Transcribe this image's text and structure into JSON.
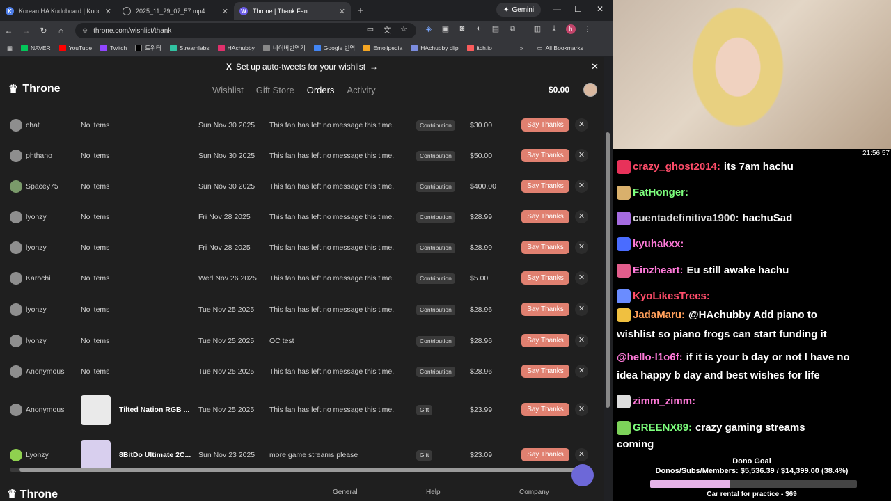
{
  "browser": {
    "tabs": [
      {
        "title": "Korean HA Kudoboard | Kudob",
        "favicon": "K"
      },
      {
        "title": "2025_11_29_07_57.mp4",
        "favicon": "globe"
      },
      {
        "title": "Throne | Thank Fan",
        "favicon": "W"
      }
    ],
    "gemini": "Gemini",
    "url": "throne.com/wishlist/thank",
    "bookmarks": [
      "NAVER",
      "YouTube",
      "Twitch",
      "트위터",
      "Streamlabs",
      "HAchubby",
      "네이버번역기",
      "Google 번역",
      "Emojipedia",
      "HAchubby clip",
      "itch.io"
    ],
    "all_bookmarks": "All Bookmarks"
  },
  "throne": {
    "banner": "Set up auto-tweets for your wishlist",
    "logo": "Throne",
    "nav": [
      "Wishlist",
      "Gift Store",
      "Orders",
      "Activity"
    ],
    "balance": "$0.00",
    "rows": [
      {
        "user": "chat",
        "items": "No items",
        "date": "Sun Nov 30 2025",
        "message": "This fan has left no message this time.",
        "type": "Contribution",
        "amount": "$30.00"
      },
      {
        "user": "phthano",
        "items": "No items",
        "date": "Sun Nov 30 2025",
        "message": "This fan has left no message this time.",
        "type": "Contribution",
        "amount": "$50.00"
      },
      {
        "user": "Spacey75",
        "items": "No items",
        "date": "Sun Nov 30 2025",
        "message": "This fan has left no message this time.",
        "type": "Contribution",
        "amount": "$400.00"
      },
      {
        "user": "lyonzy",
        "items": "No items",
        "date": "Fri Nov 28 2025",
        "message": "This fan has left no message this time.",
        "type": "Contribution",
        "amount": "$28.99"
      },
      {
        "user": "lyonzy",
        "items": "No items",
        "date": "Fri Nov 28 2025",
        "message": "This fan has left no message this time.",
        "type": "Contribution",
        "amount": "$28.99"
      },
      {
        "user": "Karochi",
        "items": "No items",
        "date": "Wed Nov 26 2025",
        "message": "This fan has left no message this time.",
        "type": "Contribution",
        "amount": "$5.00"
      },
      {
        "user": "lyonzy",
        "items": "No items",
        "date": "Tue Nov 25 2025",
        "message": "This fan has left no message this time.",
        "type": "Contribution",
        "amount": "$28.96"
      },
      {
        "user": "lyonzy",
        "items": "No items",
        "date": "Tue Nov 25 2025",
        "message": "OC test",
        "type": "Contribution",
        "amount": "$28.96"
      },
      {
        "user": "Anonymous",
        "items": "No items",
        "date": "Tue Nov 25 2025",
        "message": "This fan has left no message this time.",
        "type": "Contribution",
        "amount": "$28.96"
      },
      {
        "user": "Anonymous",
        "items": "Tilted Nation RGB ...",
        "date": "Tue Nov 25 2025",
        "message": "This fan has left no message this time.",
        "type": "Gift",
        "amount": "$23.99"
      },
      {
        "user": "Lyonzy",
        "items": "8BitDo Ultimate 2C...",
        "date": "Sun Nov 23 2025",
        "message": "more game streams please",
        "type": "Gift",
        "amount": "$23.09"
      }
    ],
    "say_thanks": "Say Thanks",
    "footer": {
      "logo": "Throne",
      "cols": [
        "General",
        "Help",
        "Company"
      ]
    }
  },
  "stream": {
    "clock": "21:56:57",
    "chat": [
      {
        "user": "crazy_ghost2014:",
        "color": "#ff4d6a",
        "text": "its 7am hachu"
      },
      {
        "user": "FatHonger:",
        "color": "#7dff7d",
        "text": ""
      },
      {
        "user": "cuentadefinitiva1900:",
        "color": "#dcdcdc",
        "text": "hachuSad"
      },
      {
        "user": "kyuhakxx:",
        "color": "#ff7ad9",
        "text": ""
      },
      {
        "user": "Einzheart:",
        "color": "#ff7ad9",
        "text": "Eu still awake hachu"
      },
      {
        "user": "KyoLikesTrees:",
        "color": "#ff4d6a",
        "text": ""
      },
      {
        "user": "JadaMaru:",
        "color": "#ff9f5a",
        "text": "@HAchubby Add piano to"
      },
      {
        "user": "",
        "color": "#ffffff",
        "text": "wishlist so piano frogs can start funding it"
      },
      {
        "user": "@hello-l1o6f:",
        "color": "#ff7ad9",
        "text": "if it is your b day or not I have no"
      },
      {
        "user": "",
        "color": "#ffffff",
        "text": "idea happy b day and best wishes for life"
      },
      {
        "user": "zimm_zimm:",
        "color": "#ff7ad9",
        "text": ""
      },
      {
        "user": "GREENX89:",
        "color": "#7dff7d",
        "text": "crazy gaming streams"
      },
      {
        "user": "",
        "color": "#ffffff",
        "text": "coming"
      }
    ],
    "goal_title": "Dono Goal",
    "goal_text": "Donos/Subs/Members: $5,536.39 / $14,399.00 (38.4%)",
    "goal_progress": 0.384,
    "goal_sub": "Car rental for practice - $69"
  }
}
